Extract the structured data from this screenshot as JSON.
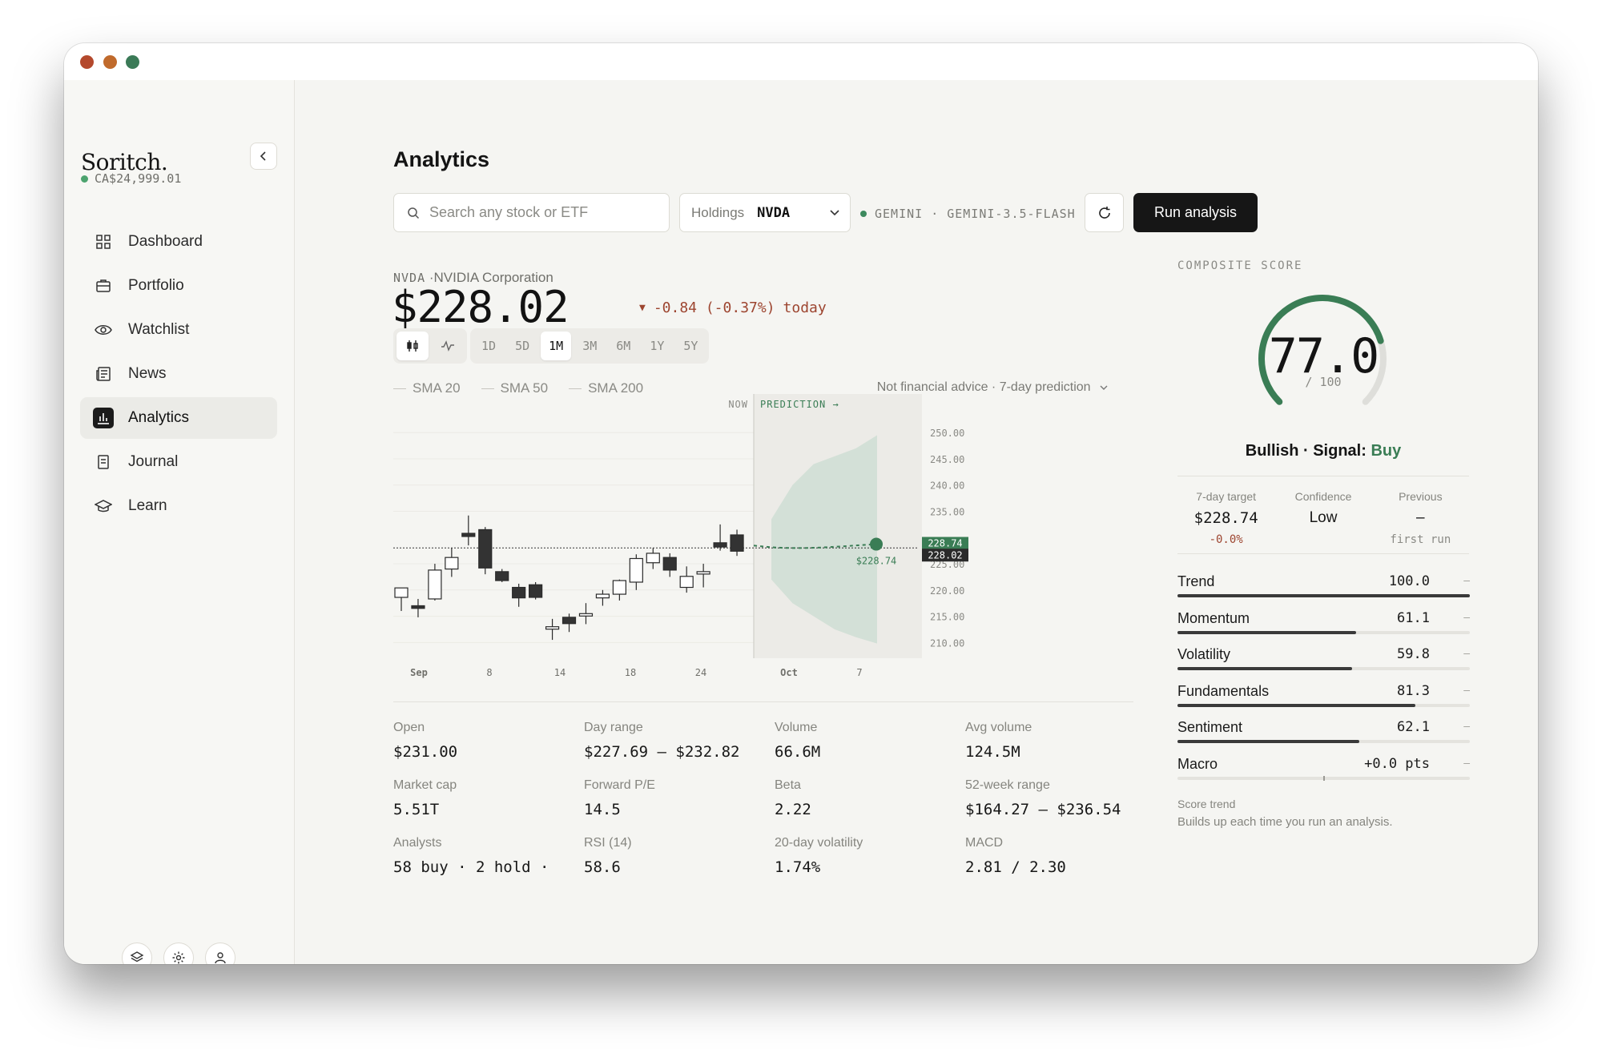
{
  "sidebar": {
    "brand": "Soritch.",
    "balance": "CA$24,999.01",
    "items": [
      {
        "label": "Dashboard",
        "icon": "grid-icon"
      },
      {
        "label": "Portfolio",
        "icon": "briefcase-icon"
      },
      {
        "label": "Watchlist",
        "icon": "eye-icon"
      },
      {
        "label": "News",
        "icon": "newspaper-icon"
      },
      {
        "label": "Analytics",
        "icon": "bar-chart-icon",
        "active": true
      },
      {
        "label": "Journal",
        "icon": "notebook-icon"
      },
      {
        "label": "Learn",
        "icon": "graduation-cap-icon"
      }
    ],
    "footer_icons": [
      "layers-icon",
      "gear-icon",
      "user-icon"
    ]
  },
  "header": {
    "title": "Analytics",
    "search_placeholder": "Search any stock or ETF",
    "holdings_label": "Holdings",
    "holdings_value": "NVDA",
    "provider": "GEMINI",
    "separator": "·",
    "model": "GEMINI-3.5-FLASH",
    "run_button": "Run analysis"
  },
  "quote": {
    "symbol": "NVDA",
    "name": "·NVIDIA Corporation",
    "price": "$228.02",
    "arrow": "▼",
    "change": "-0.84 (-0.37%)",
    "change_suffix": "today"
  },
  "controls": {
    "ranges": [
      "1D",
      "5D",
      "1M",
      "3M",
      "6M",
      "1Y",
      "5Y"
    ],
    "active_range": "1M",
    "sma": [
      "SMA 20",
      "SMA 50",
      "SMA 200"
    ],
    "advice": "Not financial advice · 7-day prediction"
  },
  "chart_data": {
    "type": "candlestick",
    "x_ticks": [
      "Sep",
      "8",
      "14",
      "18",
      "24",
      "Oct",
      "7"
    ],
    "y_ticks": [
      250,
      245,
      240,
      235,
      225,
      220,
      215,
      210
    ],
    "ylim": [
      207,
      254
    ],
    "now_label": "NOW",
    "prediction_label": "PREDICTION →",
    "current_price": 228.02,
    "current_price_label": "228.02",
    "target_price": 228.74,
    "target_price_label": "228.74",
    "target_annotation": "$228.74",
    "candles": [
      {
        "o": 218.6,
        "h": 220.2,
        "l": 216.0,
        "c": 220.4
      },
      {
        "o": 217.0,
        "h": 218.3,
        "l": 214.8,
        "c": 216.5
      },
      {
        "o": 218.3,
        "h": 225.0,
        "l": 218.0,
        "c": 223.8
      },
      {
        "o": 224.0,
        "h": 228.0,
        "l": 222.5,
        "c": 226.2
      },
      {
        "o": 230.8,
        "h": 234.2,
        "l": 228.5,
        "c": 230.2
      },
      {
        "o": 231.5,
        "h": 232.0,
        "l": 223.0,
        "c": 224.2
      },
      {
        "o": 223.5,
        "h": 224.0,
        "l": 221.5,
        "c": 221.8
      },
      {
        "o": 220.5,
        "h": 221.2,
        "l": 216.8,
        "c": 218.5
      },
      {
        "o": 221.0,
        "h": 221.5,
        "l": 218.2,
        "c": 218.6
      },
      {
        "o": 213.0,
        "h": 214.5,
        "l": 210.5,
        "c": 213.0
      },
      {
        "o": 214.8,
        "h": 215.5,
        "l": 212.0,
        "c": 213.6
      },
      {
        "o": 215.5,
        "h": 217.5,
        "l": 213.5,
        "c": 215.5
      },
      {
        "o": 218.5,
        "h": 220.0,
        "l": 217.0,
        "c": 219.2
      },
      {
        "o": 219.2,
        "h": 222.0,
        "l": 218.0,
        "c": 221.8
      },
      {
        "o": 221.5,
        "h": 226.8,
        "l": 220.0,
        "c": 226.0
      },
      {
        "o": 225.2,
        "h": 228.0,
        "l": 224.0,
        "c": 227.0
      },
      {
        "o": 226.2,
        "h": 227.0,
        "l": 222.5,
        "c": 223.8
      },
      {
        "o": 220.5,
        "h": 224.5,
        "l": 219.5,
        "c": 222.6
      },
      {
        "o": 223.5,
        "h": 225.0,
        "l": 220.5,
        "c": 223.5
      },
      {
        "o": 229.0,
        "h": 232.5,
        "l": 227.5,
        "c": 228.2
      },
      {
        "o": 230.5,
        "h": 231.5,
        "l": 226.5,
        "c": 227.4
      }
    ],
    "prediction_band_upper": [
      233.5,
      240.0,
      244.0,
      245.5,
      247.0,
      249.5
    ],
    "prediction_band_lower": [
      222.0,
      217.5,
      215.0,
      212.5,
      211.0,
      209.8
    ]
  },
  "stats": [
    {
      "label": "Open",
      "value": "$231.00"
    },
    {
      "label": "Day range",
      "value": "$227.69 – $232.82"
    },
    {
      "label": "Volume",
      "value": "66.6M"
    },
    {
      "label": "Avg volume",
      "value": "124.5M"
    },
    {
      "label": "Market cap",
      "value": "5.51T"
    },
    {
      "label": "Forward P/E",
      "value": "14.5"
    },
    {
      "label": "Beta",
      "value": "2.22"
    },
    {
      "label": "52-week range",
      "value": "$164.27 – $236.54"
    },
    {
      "label": "Analysts",
      "value": "58 buy · 2 hold · "
    },
    {
      "label": "RSI (14)",
      "value": "58.6"
    },
    {
      "label": "20-day volatility",
      "value": "1.74%"
    },
    {
      "label": "MACD",
      "value": "2.81 / 2.30"
    }
  ],
  "composite": {
    "label": "COMPOSITE SCORE",
    "score": "77.0",
    "score_value": 77.0,
    "max": "/ 100",
    "verdict": "Bullish",
    "signal_label": "· Signal:",
    "signal": "Buy",
    "target_label": "7-day target",
    "target_value": "$228.74",
    "target_change": "-0.0%",
    "confidence_label": "Confidence",
    "confidence_value": "Low",
    "previous_label": "Previous",
    "previous_value": "–",
    "previous_sub": "first run",
    "factors": [
      {
        "name": "Trend",
        "value": "100.0",
        "level": 100,
        "delta": "–"
      },
      {
        "name": "Momentum",
        "value": "61.1",
        "level": 61.1,
        "delta": "–"
      },
      {
        "name": "Volatility",
        "value": "59.8",
        "level": 59.8,
        "delta": "–"
      },
      {
        "name": "Fundamentals",
        "value": "81.3",
        "level": 81.3,
        "delta": "–"
      },
      {
        "name": "Sentiment",
        "value": "62.1",
        "level": 62.1,
        "delta": "–"
      },
      {
        "name": "Macro",
        "value": "+0.0 pts",
        "level": 0,
        "delta": "–"
      }
    ],
    "trend_title": "Score trend",
    "trend_sub": "Builds up each time you run an analysis."
  },
  "colors": {
    "accent_green": "#3a7d55",
    "negative_red": "#9d4530",
    "dark": "#161616"
  }
}
